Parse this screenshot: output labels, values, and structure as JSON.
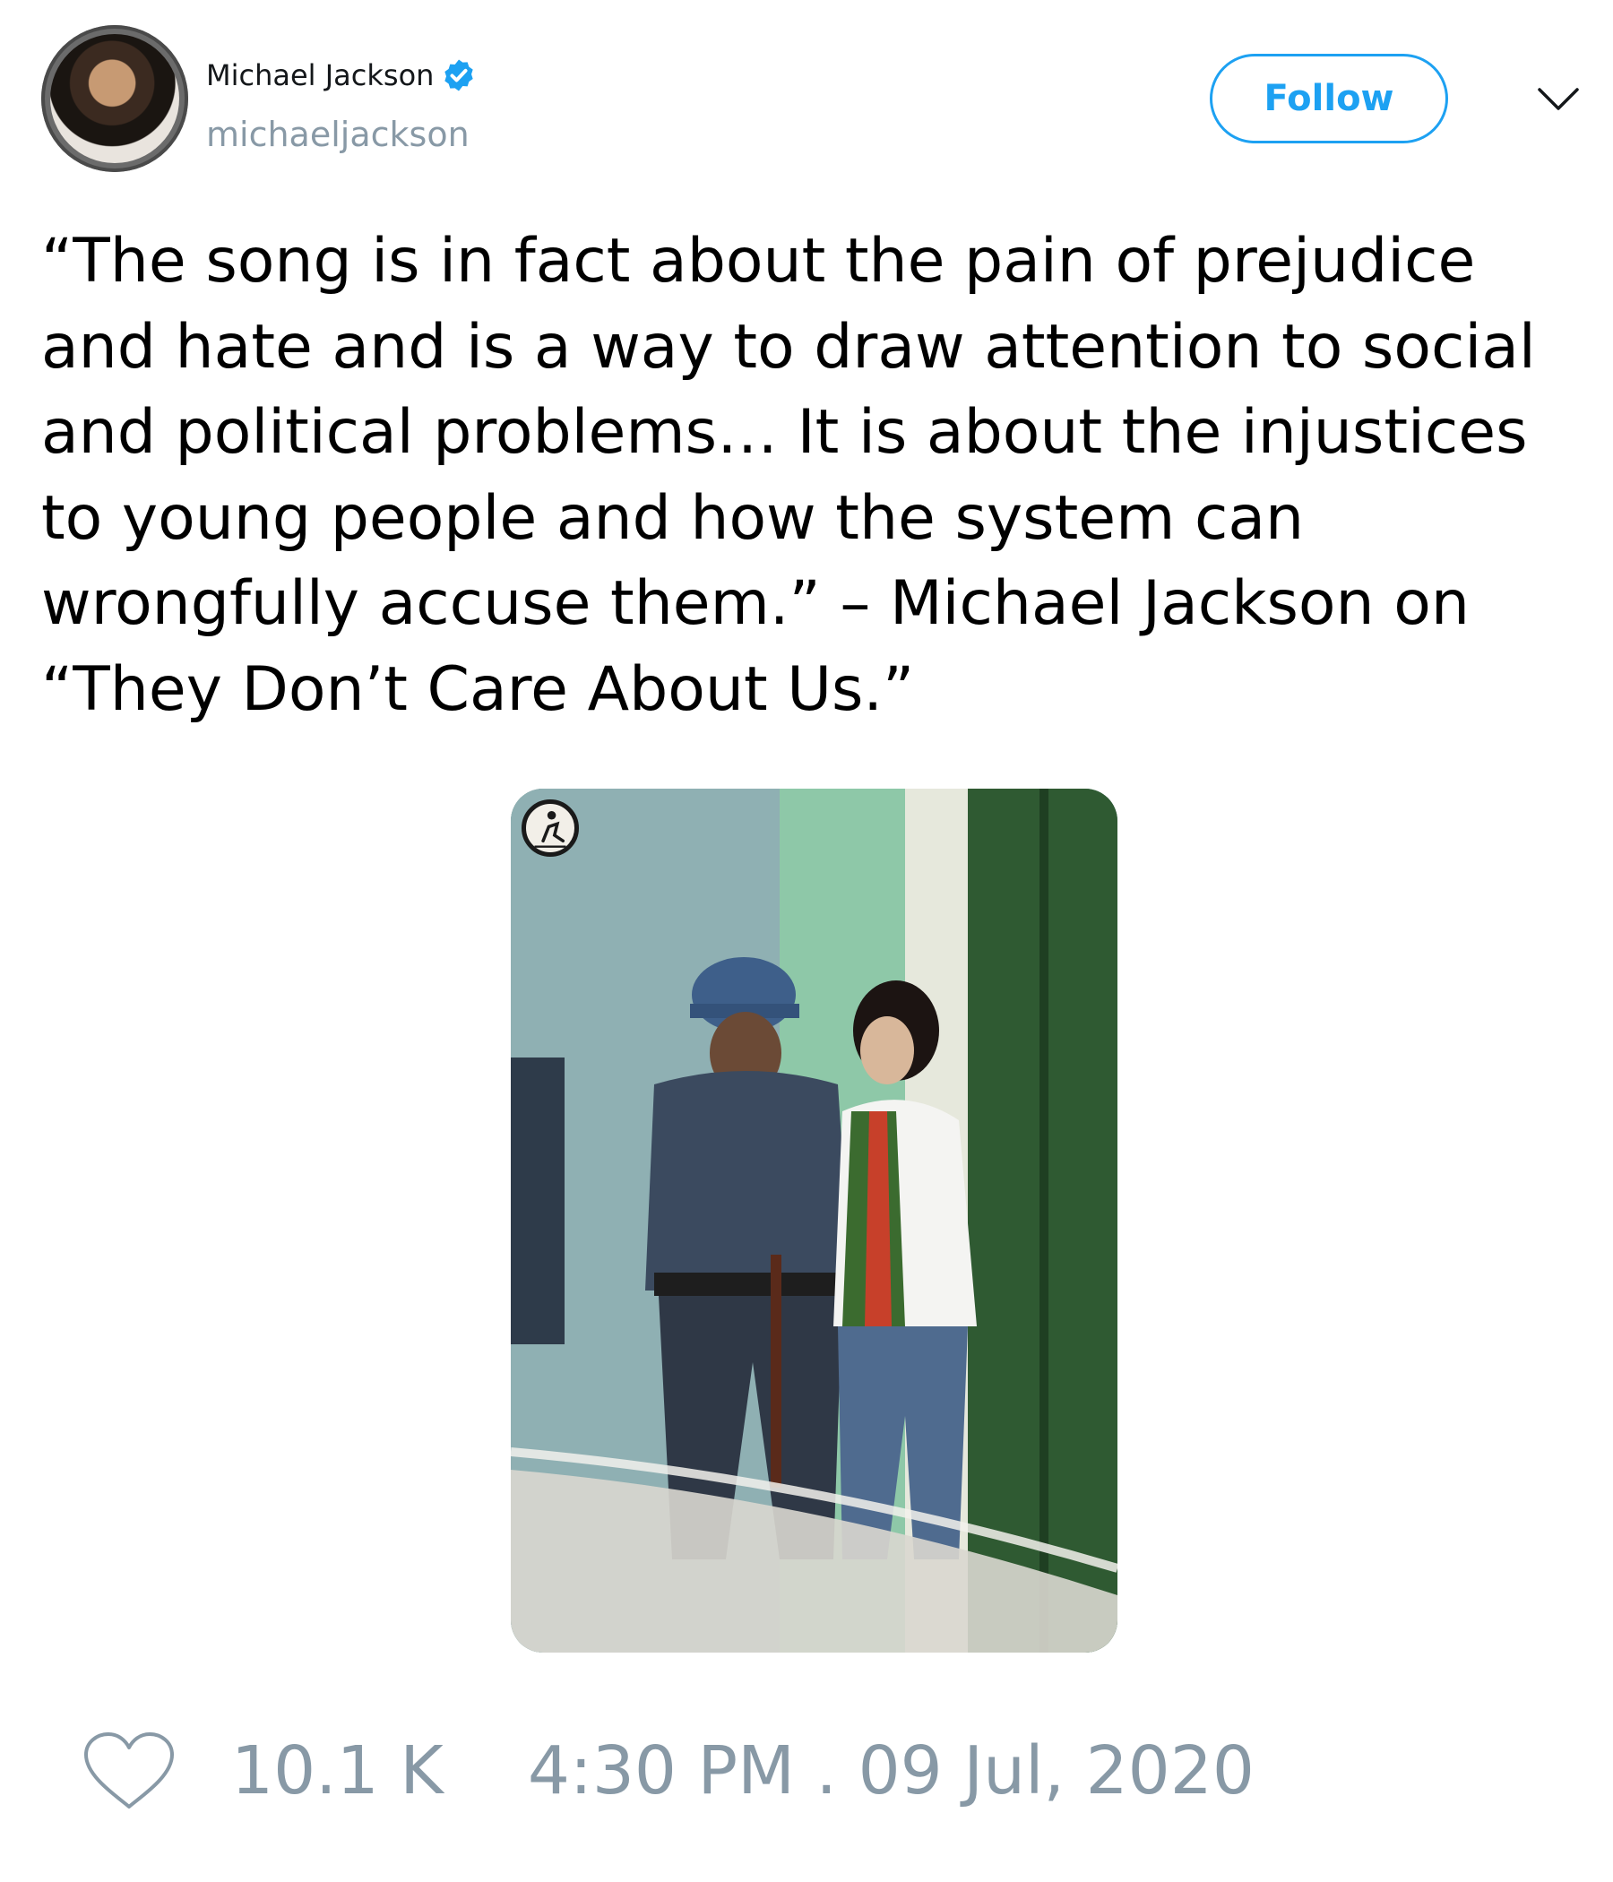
{
  "author": {
    "display_name": "Michael Jackson",
    "handle": "michaeljackson",
    "verified": true,
    "avatar_icon": "avatar-photo"
  },
  "actions": {
    "follow_label": "Follow",
    "menu_icon": "chevron-down-icon"
  },
  "tweet": {
    "text": "“The song is in fact about the pain of prejudice\nand hate and is a way to draw attention to social\nand political problems… It is about the injustices\nto young people and how the system can\nwrongfully accuse them.” – Michael Jackson on\n“They Don’t Care About Us.”"
  },
  "media": {
    "type": "photo",
    "badge_icon": "watermark-badge-icon"
  },
  "footer": {
    "like_icon": "heart-icon",
    "likes": "10.1 K",
    "timestamp": "4:30 PM . 09 Jul, 2020"
  },
  "colors": {
    "accent": "#1da1f2",
    "muted_text": "#8899a6",
    "text": "#000000"
  }
}
